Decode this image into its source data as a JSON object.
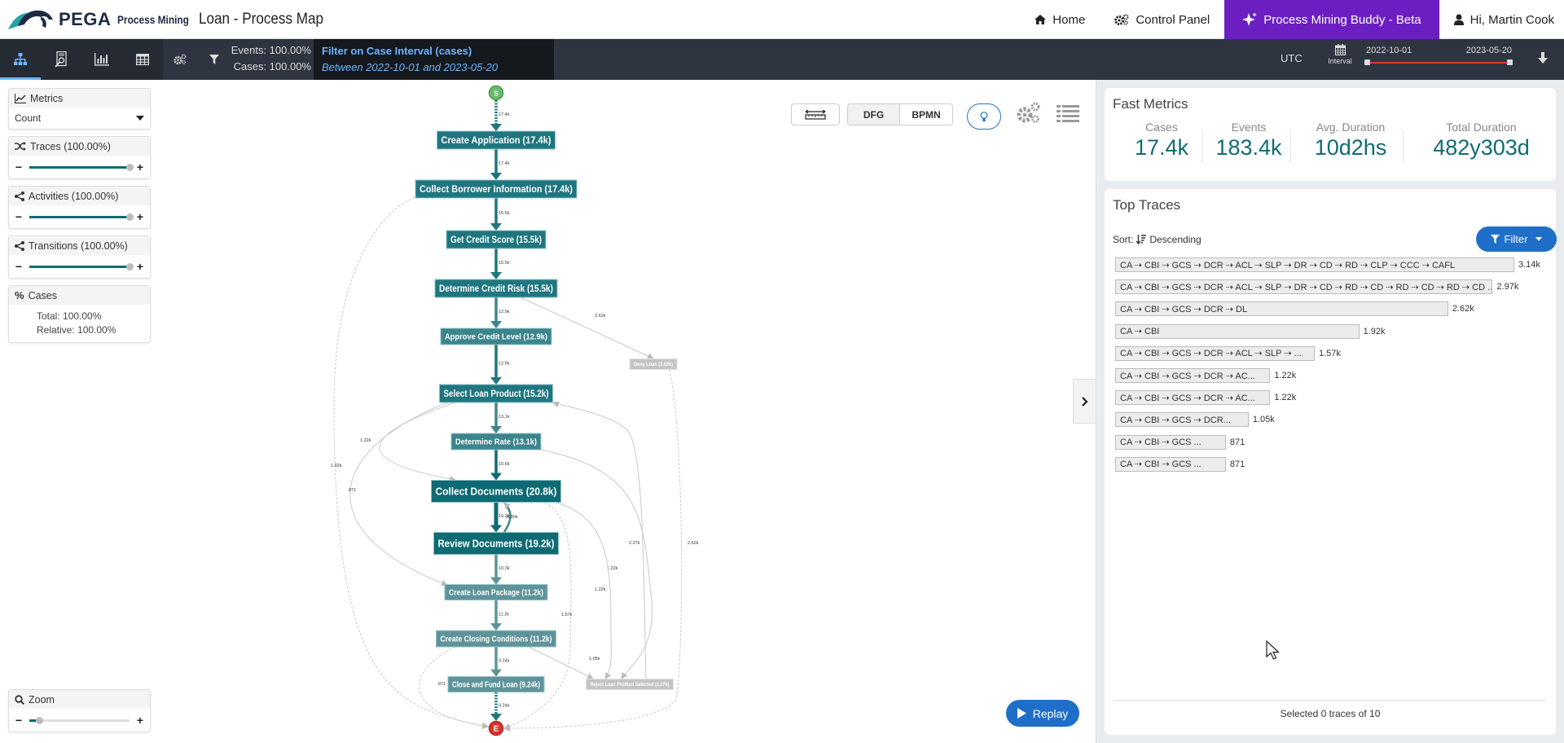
{
  "header": {
    "brand": "PEGA",
    "product": "Process Mining",
    "title": "Loan - Process Map",
    "nav": {
      "home": "Home",
      "control_panel": "Control Panel",
      "buddy": "Process Mining Buddy - Beta",
      "user": "Hi, Martin Cook"
    },
    "buddy_color": "#6b1fc2"
  },
  "toolbar": {
    "icons": [
      "process-map-icon",
      "case-explorer-icon",
      "statistics-icon",
      "table-icon",
      "settings-icon",
      "filter-icon"
    ],
    "events": "Events: 100.00%",
    "cases": "Cases: 100.00%",
    "filter_title": "Filter on Case Interval (cases)",
    "filter_subtitle": "Between 2022-10-01 and 2023-05-20",
    "timezone": "UTC",
    "interval_label": "Interval",
    "date_start": "2022-10-01",
    "date_end": "2023-05-20"
  },
  "left_panel": {
    "metrics": {
      "title": "Metrics",
      "selected": "Count"
    },
    "traces": {
      "title": "Traces (100.00%)",
      "value_pct": 100
    },
    "activities": {
      "title": "Activities (100.00%)",
      "value_pct": 100
    },
    "transitions": {
      "title": "Transitions (100.00%)",
      "value_pct": 100
    },
    "cases": {
      "title": "Cases",
      "total": "Total: 100.00%",
      "relative": "Relative: 100.00%"
    },
    "zoom": {
      "title": "Zoom",
      "value_pct": 10
    }
  },
  "map_controls": {
    "dfg": "DFG",
    "bpmn": "BPMN",
    "replay": "Replay"
  },
  "process_map": {
    "start_label": "S",
    "end_label": "E",
    "nodes": [
      {
        "id": "CA",
        "label": "Create Application  (17.4k)",
        "strong": 1
      },
      {
        "id": "CBI",
        "label": "Collect Borrower Information  (17.4k)",
        "strong": 1
      },
      {
        "id": "GCS",
        "label": "Get Credit Score  (15.5k)",
        "strong": 1
      },
      {
        "id": "DCR",
        "label": "Determine Credit Risk  (15.5k)",
        "strong": 1
      },
      {
        "id": "ACL",
        "label": "Approve Credit Level  (12.9k)",
        "strong": 0.8
      },
      {
        "id": "SLP",
        "label": "Select Loan Product  (15.2k)",
        "strong": 1
      },
      {
        "id": "DR",
        "label": "Determine Rate  (13.1k)",
        "strong": 0.8
      },
      {
        "id": "CD",
        "label": "Collect Documents  (20.8k)",
        "strong": 1.2
      },
      {
        "id": "RD",
        "label": "Review Documents  (19.2k)",
        "strong": 1.2
      },
      {
        "id": "CLP",
        "label": "Create Loan Package  (11.2k)",
        "strong": 0.6
      },
      {
        "id": "CCC",
        "label": "Create Closing Conditions  (11.2k)",
        "strong": 0.6
      },
      {
        "id": "CAFL",
        "label": "Close and Fund Loan  (9.24k)",
        "strong": 0.6
      },
      {
        "id": "DL",
        "label": "Deny Loan  (2.62k)",
        "strong": 0
      },
      {
        "id": "RLPS",
        "label": "Reject Loan Product Selected  (2.27k)",
        "strong": 0
      }
    ],
    "edges": [
      {
        "from": "S",
        "to": "CA",
        "label": "17.4k"
      },
      {
        "from": "CA",
        "to": "CBI",
        "label": "17.4k"
      },
      {
        "from": "CBI",
        "to": "GCS",
        "label": "15.5k"
      },
      {
        "from": "GCS",
        "to": "DCR",
        "label": "15.5k"
      },
      {
        "from": "DCR",
        "to": "ACL",
        "label": "12.9k"
      },
      {
        "from": "DCR",
        "to": "DL",
        "label": "2.62k"
      },
      {
        "from": "ACL",
        "to": "SLP",
        "label": "12.9k"
      },
      {
        "from": "SLP",
        "to": "DR",
        "label": "13.1k"
      },
      {
        "from": "SLP",
        "to": "CD",
        "label": "1.22k"
      },
      {
        "from": "DR",
        "to": "CD",
        "label": "10.6k"
      },
      {
        "from": "CD",
        "to": "RD",
        "label": "19.2k"
      },
      {
        "from": "RD",
        "to": "CD",
        "label": "8.90k"
      },
      {
        "from": "RD",
        "to": "CLP",
        "label": "10.3k"
      },
      {
        "from": "CLP",
        "to": "CCC",
        "label": "11.2k"
      },
      {
        "from": "CCC",
        "to": "CAFL",
        "label": "9.24k"
      },
      {
        "from": "CCC",
        "to": "RLPS",
        "label": "1.05k"
      },
      {
        "from": "CAFL",
        "to": "E",
        "label": "9.24k"
      },
      {
        "from": "CBI",
        "to": "E",
        "label": "1.92k"
      },
      {
        "from": "SLP",
        "to": "CLP",
        "label": "871"
      },
      {
        "from": "CCC",
        "to": "E",
        "label": "871"
      },
      {
        "from": "CD",
        "to": "E",
        "label": "1.57k"
      },
      {
        "from": "DR",
        "to": "RLPS",
        "label": "1.22k"
      },
      {
        "from": "RLPS",
        "to": "SLP",
        "label": "2.27k"
      },
      {
        "from": "RD",
        "to": "RLPS",
        "label": "1.22k"
      },
      {
        "from": "DL",
        "to": "E",
        "label": "2.62k"
      }
    ]
  },
  "fast_metrics": {
    "title": "Fast Metrics",
    "items": [
      {
        "label": "Cases",
        "value": "17.4k"
      },
      {
        "label": "Events",
        "value": "183.4k"
      },
      {
        "label": "Avg. Duration",
        "value": "10d2hs"
      },
      {
        "label": "Total Duration",
        "value": "482y303d"
      }
    ]
  },
  "top_traces": {
    "title": "Top Traces",
    "sort_label": "Sort:",
    "sort_value": "Descending",
    "filter_label": "Filter",
    "rows": [
      {
        "trace": "CA → CBI → GCS → DCR → ACL → SLP → DR → CD → RD → CLP → CCC → CAFL",
        "count": "3.14k",
        "value": 3140
      },
      {
        "trace": "CA → CBI → GCS → DCR → ACL → SLP → DR → CD → RD → CD → RD → CD → RD → CD ...",
        "count": "2.97k",
        "value": 2970
      },
      {
        "trace": "CA → CBI → GCS → DCR → DL",
        "count": "2.62k",
        "value": 2620
      },
      {
        "trace": "CA → CBI",
        "count": "1.92k",
        "value": 1920
      },
      {
        "trace": "CA → CBI → GCS → DCR → ACL → SLP → ...",
        "count": "1.57k",
        "value": 1570
      },
      {
        "trace": "CA → CBI → GCS → DCR → AC...",
        "count": "1.22k",
        "value": 1220
      },
      {
        "trace": "CA → CBI → GCS → DCR → AC...",
        "count": "1.22k",
        "value": 1220
      },
      {
        "trace": "CA → CBI → GCS → DCR...",
        "count": "1.05k",
        "value": 1050
      },
      {
        "trace": "CA → CBI → GCS ...",
        "count": "871",
        "value": 871
      },
      {
        "trace": "CA → CBI → GCS ...",
        "count": "871",
        "value": 871
      }
    ],
    "footer": "Selected 0 traces of 10"
  }
}
